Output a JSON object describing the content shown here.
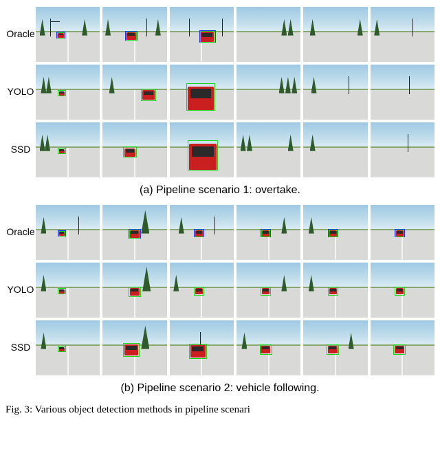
{
  "row_labels": {
    "oracle": "Oracle",
    "yolo": "YOLO",
    "ssd": "SSD"
  },
  "subcaptions": {
    "a": "(a) Pipeline scenario 1: overtake.",
    "b": "(b) Pipeline scenario 2: vehicle following."
  },
  "figcaption_prefix": "Fig. 3: Various object detection methods in pipeline scenari"
}
